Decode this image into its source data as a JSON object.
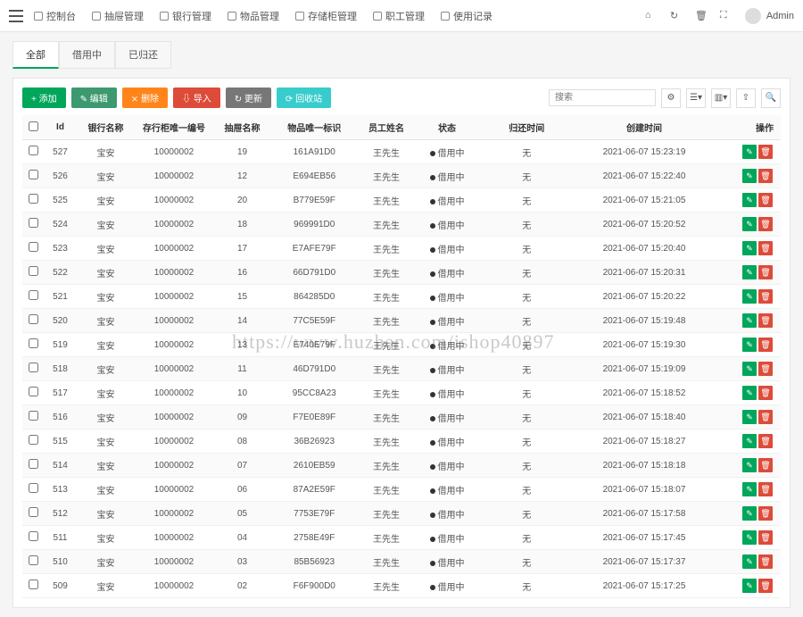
{
  "topnav": {
    "items": [
      "控制台",
      "抽屉管理",
      "银行管理",
      "物品管理",
      "存储柜管理",
      "职工管理",
      "使用记录"
    ],
    "user": "Admin"
  },
  "tabs": [
    "全部",
    "借用中",
    "已归还"
  ],
  "toolbar": {
    "add": "+ 添加",
    "edit": "✎ 编辑",
    "delete": "⨯ 删除",
    "import": "⇩ 导入",
    "refresh": "↻ 更新",
    "recycle": "⟳ 回收站",
    "search_placeholder": "搜索"
  },
  "columns": [
    "",
    "Id",
    "银行名称",
    "存行柜唯一编号",
    "抽屉名称",
    "物品唯一标识",
    "员工姓名",
    "状态",
    "归还时间",
    "创建时间",
    "操作"
  ],
  "status_label": "借用中",
  "rows": [
    {
      "id": "527",
      "bank": "宝安",
      "sn": "10000002",
      "drawer": "19",
      "uid": "161A91D0",
      "emp": "王先生",
      "ret": "无",
      "created": "2021-06-07 15:23:19"
    },
    {
      "id": "526",
      "bank": "宝安",
      "sn": "10000002",
      "drawer": "12",
      "uid": "E694EB56",
      "emp": "王先生",
      "ret": "无",
      "created": "2021-06-07 15:22:40"
    },
    {
      "id": "525",
      "bank": "宝安",
      "sn": "10000002",
      "drawer": "20",
      "uid": "B779E59F",
      "emp": "王先生",
      "ret": "无",
      "created": "2021-06-07 15:21:05"
    },
    {
      "id": "524",
      "bank": "宝安",
      "sn": "10000002",
      "drawer": "18",
      "uid": "969991D0",
      "emp": "王先生",
      "ret": "无",
      "created": "2021-06-07 15:20:52"
    },
    {
      "id": "523",
      "bank": "宝安",
      "sn": "10000002",
      "drawer": "17",
      "uid": "E7AFE79F",
      "emp": "王先生",
      "ret": "无",
      "created": "2021-06-07 15:20:40"
    },
    {
      "id": "522",
      "bank": "宝安",
      "sn": "10000002",
      "drawer": "16",
      "uid": "66D791D0",
      "emp": "王先生",
      "ret": "无",
      "created": "2021-06-07 15:20:31"
    },
    {
      "id": "521",
      "bank": "宝安",
      "sn": "10000002",
      "drawer": "15",
      "uid": "864285D0",
      "emp": "王先生",
      "ret": "无",
      "created": "2021-06-07 15:20:22"
    },
    {
      "id": "520",
      "bank": "宝安",
      "sn": "10000002",
      "drawer": "14",
      "uid": "77C5E59F",
      "emp": "王先生",
      "ret": "无",
      "created": "2021-06-07 15:19:48"
    },
    {
      "id": "519",
      "bank": "宝安",
      "sn": "10000002",
      "drawer": "13",
      "uid": "E740E79F",
      "emp": "王先生",
      "ret": "无",
      "created": "2021-06-07 15:19:30"
    },
    {
      "id": "518",
      "bank": "宝安",
      "sn": "10000002",
      "drawer": "11",
      "uid": "46D791D0",
      "emp": "王先生",
      "ret": "无",
      "created": "2021-06-07 15:19:09"
    },
    {
      "id": "517",
      "bank": "宝安",
      "sn": "10000002",
      "drawer": "10",
      "uid": "95CC8A23",
      "emp": "王先生",
      "ret": "无",
      "created": "2021-06-07 15:18:52"
    },
    {
      "id": "516",
      "bank": "宝安",
      "sn": "10000002",
      "drawer": "09",
      "uid": "F7E0E89F",
      "emp": "王先生",
      "ret": "无",
      "created": "2021-06-07 15:18:40"
    },
    {
      "id": "515",
      "bank": "宝安",
      "sn": "10000002",
      "drawer": "08",
      "uid": "36B26923",
      "emp": "王先生",
      "ret": "无",
      "created": "2021-06-07 15:18:27"
    },
    {
      "id": "514",
      "bank": "宝安",
      "sn": "10000002",
      "drawer": "07",
      "uid": "2610EB59",
      "emp": "王先生",
      "ret": "无",
      "created": "2021-06-07 15:18:18"
    },
    {
      "id": "513",
      "bank": "宝安",
      "sn": "10000002",
      "drawer": "06",
      "uid": "87A2E59F",
      "emp": "王先生",
      "ret": "无",
      "created": "2021-06-07 15:18:07"
    },
    {
      "id": "512",
      "bank": "宝安",
      "sn": "10000002",
      "drawer": "05",
      "uid": "7753E79F",
      "emp": "王先生",
      "ret": "无",
      "created": "2021-06-07 15:17:58"
    },
    {
      "id": "511",
      "bank": "宝安",
      "sn": "10000002",
      "drawer": "04",
      "uid": "2758E49F",
      "emp": "王先生",
      "ret": "无",
      "created": "2021-06-07 15:17:45"
    },
    {
      "id": "510",
      "bank": "宝安",
      "sn": "10000002",
      "drawer": "03",
      "uid": "85B56923",
      "emp": "王先生",
      "ret": "无",
      "created": "2021-06-07 15:17:37"
    },
    {
      "id": "509",
      "bank": "宝安",
      "sn": "10000002",
      "drawer": "02",
      "uid": "F6F900D0",
      "emp": "王先生",
      "ret": "无",
      "created": "2021-06-07 15:17:25"
    }
  ],
  "watermark": "https://www.huzhan.com/ishop40897"
}
